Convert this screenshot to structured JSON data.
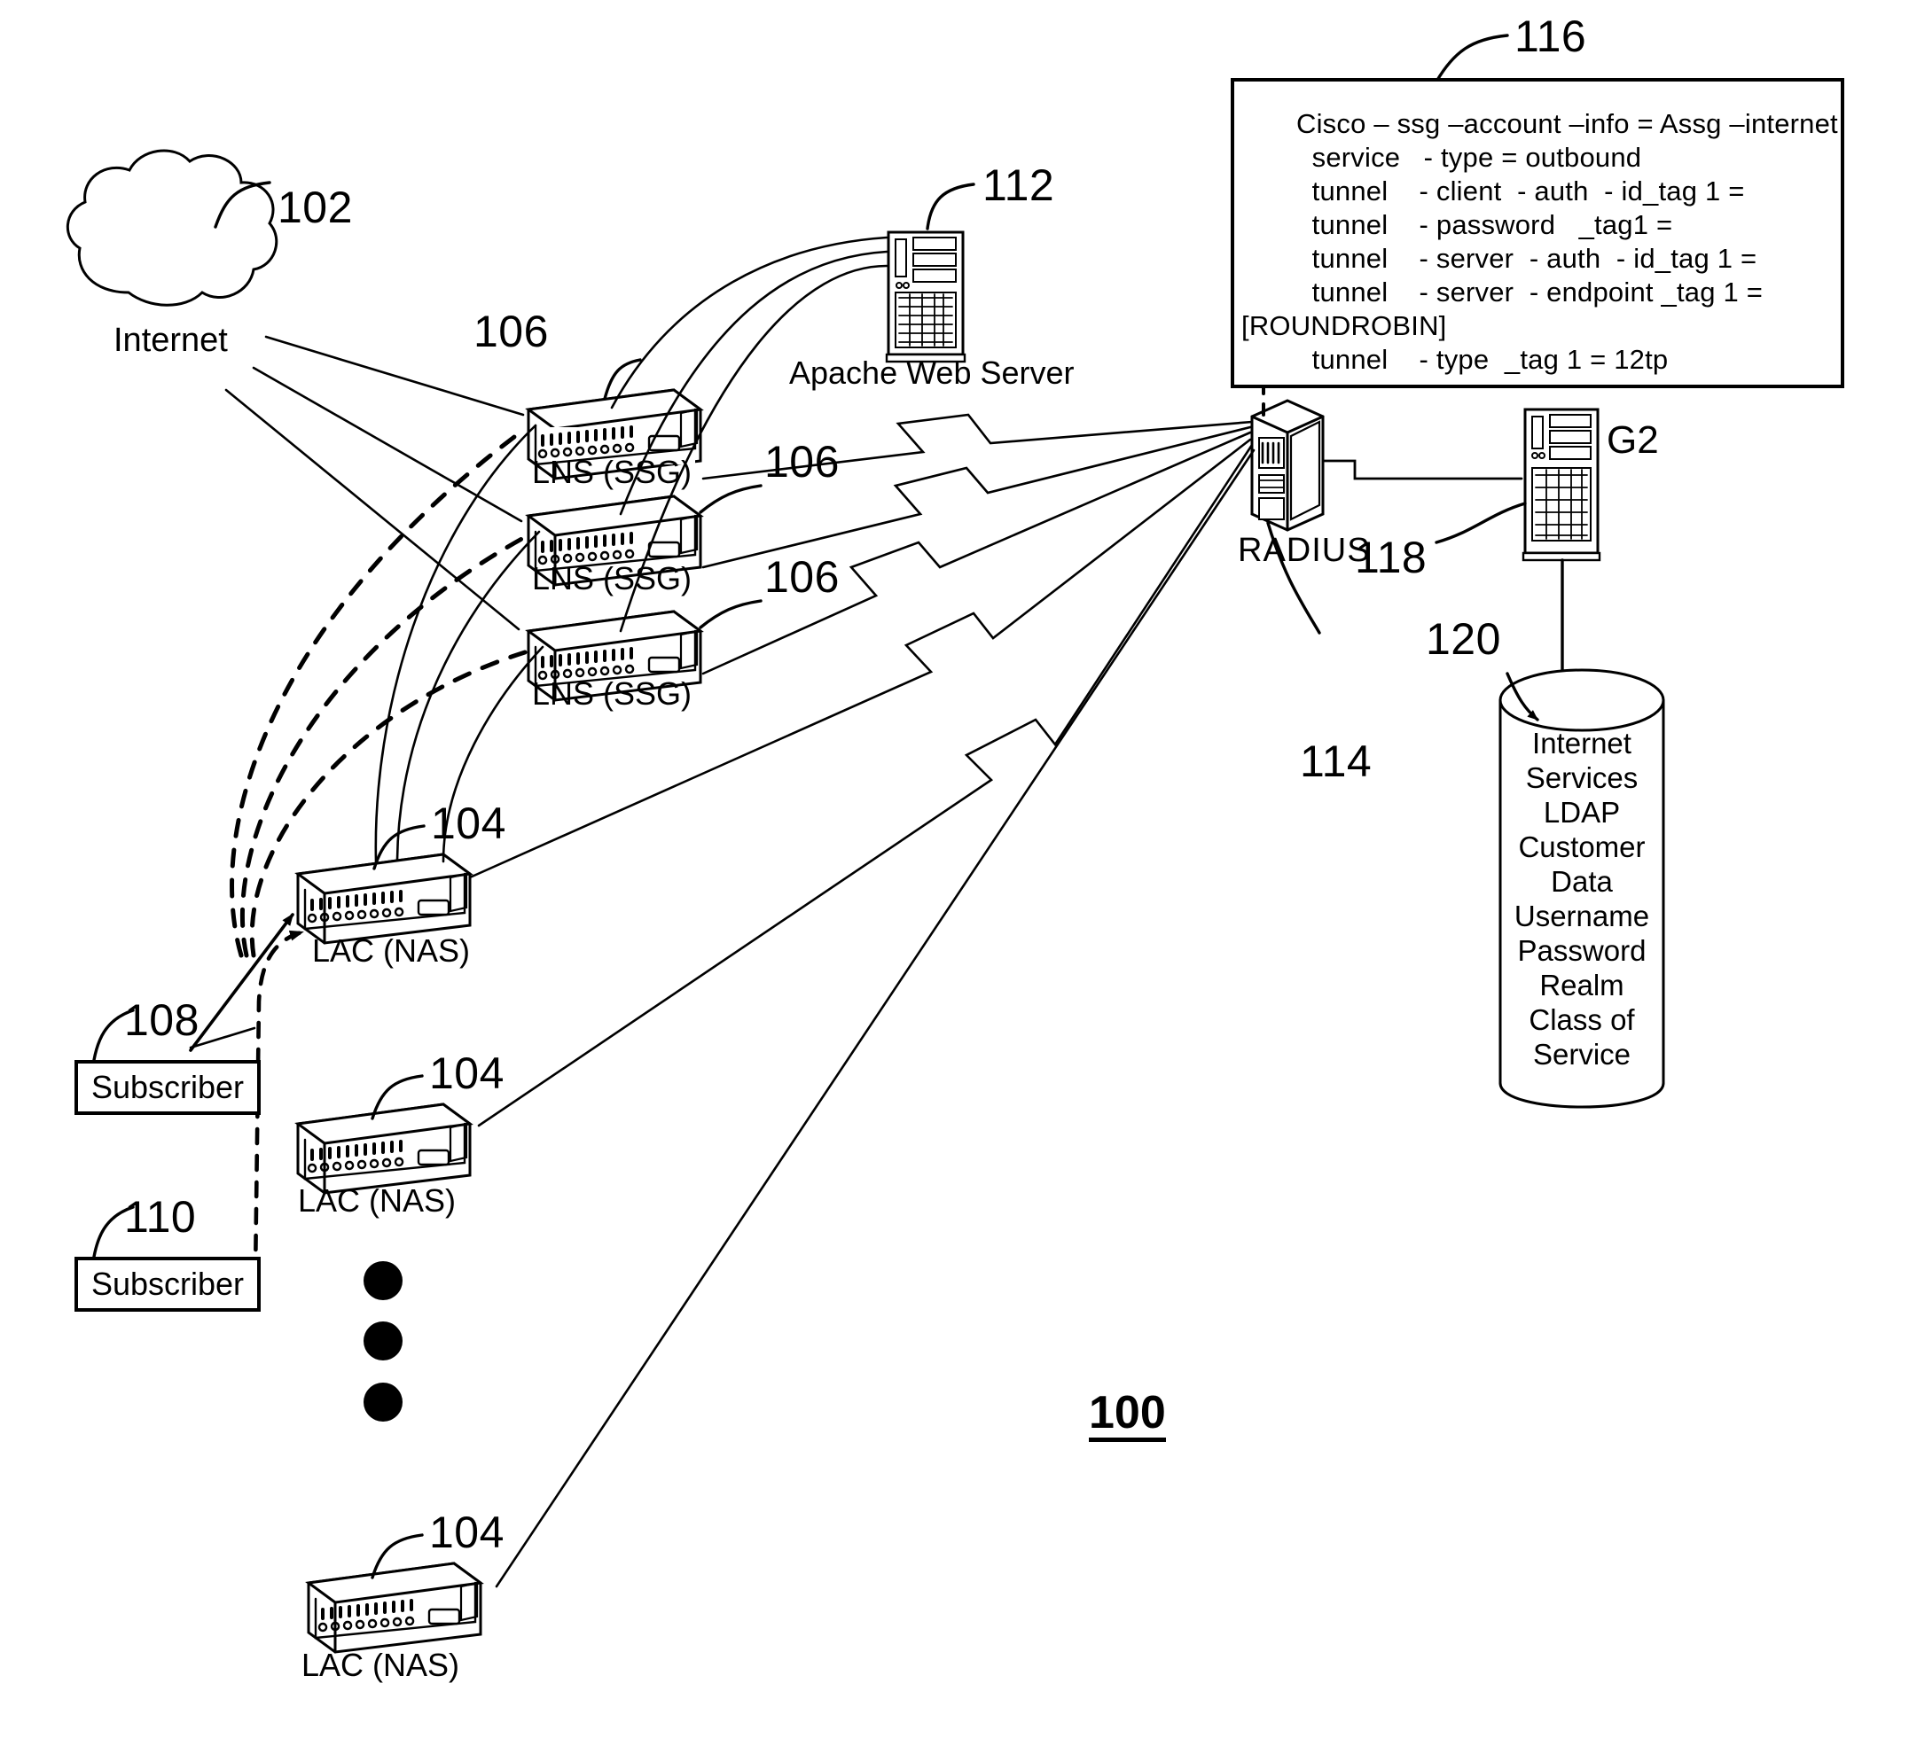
{
  "figure": {
    "number": "100"
  },
  "cloud": {
    "label": "Internet",
    "ref": "102"
  },
  "lns_routers": [
    {
      "label": "LNS (SSG)",
      "ref": "106"
    },
    {
      "label": "LNS (SSG)",
      "ref": "106"
    },
    {
      "label": "LNS (SSG)",
      "ref": "106"
    }
  ],
  "lac_routers": [
    {
      "label": "LAC  (NAS)",
      "ref": "104"
    },
    {
      "label": "LAC  (NAS)",
      "ref": "104"
    },
    {
      "label": "LAC  (NAS)",
      "ref": "104"
    }
  ],
  "web_server": {
    "label": "Apache Web Server",
    "ref": "112"
  },
  "subscribers": [
    {
      "label": "Subscriber",
      "ref": "108"
    },
    {
      "label": "Subscriber",
      "ref": "110"
    }
  ],
  "radius": {
    "label": "RADIUS",
    "ref": "114"
  },
  "g2_server": {
    "label": "G2",
    "ref": "118"
  },
  "database": {
    "ref": "120",
    "lines": [
      "Internet",
      "Services",
      "LDAP",
      "Customer",
      "Data",
      "Username",
      "Password",
      "Realm",
      "Class of",
      "Service"
    ]
  },
  "config_box": {
    "ref": "116",
    "lines": [
      "Cisco – ssg –account –info = Assg –internet",
      "  service   - type = outbound",
      "  tunnel    - client  - auth  - id_tag 1 =",
      "  tunnel    - password   _tag1 =",
      "  tunnel    - server  - auth  - id_tag 1 =",
      "  tunnel    - server  - endpoint _tag 1 =",
      "[ROUNDROBIN]",
      "  tunnel    - type  _tag 1 = 12tp"
    ]
  },
  "colors": {
    "ink": "#000000",
    "paper": "#ffffff"
  }
}
